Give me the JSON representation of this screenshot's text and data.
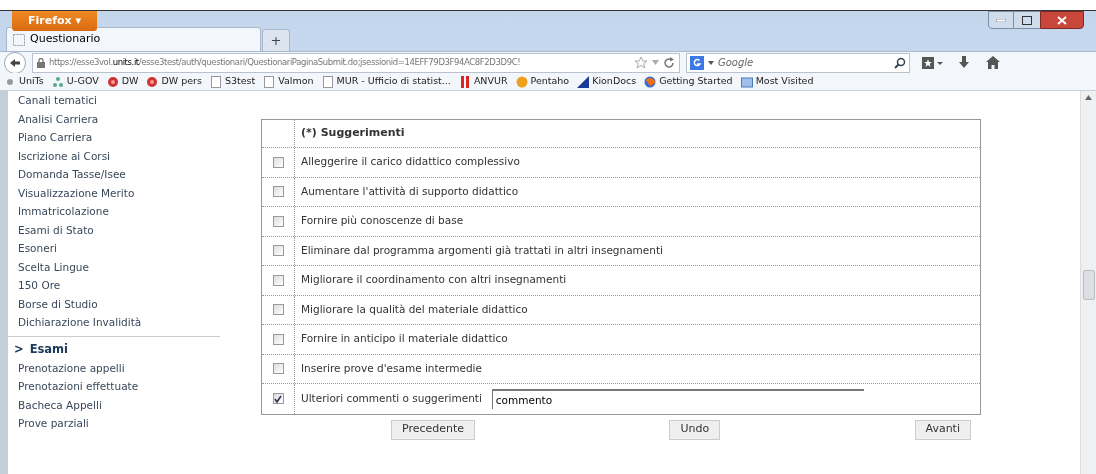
{
  "window": {
    "app_button": "Firefox ▾"
  },
  "tabs": [
    {
      "label": "Questionario",
      "selected": true
    },
    {
      "label": "+",
      "selected": false
    }
  ],
  "address_bar": {
    "prefix": "https://esse3vol.",
    "domain": "units.it",
    "path": "/esse3test/auth/questionari/QuestionariPaginaSubmit.do;jsessionid=14EFF79D3F94AC8F2D3D9C!"
  },
  "search_field": {
    "placeholder": "Google"
  },
  "bookmarks": [
    {
      "label": "UniTs",
      "kind": "dot"
    },
    {
      "label": "U-GOV",
      "kind": "nodes"
    },
    {
      "label": "DW",
      "kind": "flower"
    },
    {
      "label": "DW pers",
      "kind": "flower"
    },
    {
      "label": "S3test",
      "kind": "page"
    },
    {
      "label": "Valmon",
      "kind": "page"
    },
    {
      "label": "MUR - Ufficio di statist...",
      "kind": "page"
    },
    {
      "label": "ANVUR",
      "kind": "bars"
    },
    {
      "label": "Pentaho",
      "kind": "circle"
    },
    {
      "label": "KionDocs",
      "kind": "flag"
    },
    {
      "label": "Getting Started",
      "kind": "globe"
    },
    {
      "label": "Most Visited",
      "kind": "folder"
    }
  ],
  "sidebar": {
    "items": [
      {
        "label": "Canali tematici",
        "kind": "link"
      },
      {
        "label": "Analisi Carriera",
        "kind": "link"
      },
      {
        "label": "Piano Carriera",
        "kind": "link"
      },
      {
        "label": "Iscrizione ai Corsi",
        "kind": "link"
      },
      {
        "label": "Domanda Tasse/Isee",
        "kind": "link"
      },
      {
        "label": "Visualizzazione Merito",
        "kind": "link"
      },
      {
        "label": "Immatricolazione",
        "kind": "link"
      },
      {
        "label": "Esami di Stato",
        "kind": "link"
      },
      {
        "label": "Esoneri",
        "kind": "link"
      },
      {
        "label": "Scelta Lingue",
        "kind": "link"
      },
      {
        "label": "150 Ore",
        "kind": "link"
      },
      {
        "label": "Borse di Studio",
        "kind": "link"
      },
      {
        "label": "Dichiarazione Invalidità",
        "kind": "link"
      },
      {
        "label": "Esami",
        "kind": "section",
        "marker": ">"
      },
      {
        "label": "Prenotazione appelli",
        "kind": "link"
      },
      {
        "label": "Prenotazioni effettuate",
        "kind": "link"
      },
      {
        "label": "Bacheca Appelli",
        "kind": "link"
      },
      {
        "label": "Prove parziali",
        "kind": "link"
      }
    ]
  },
  "table": {
    "header": "(*) Suggerimenti",
    "rows": [
      {
        "label": "Alleggerire il carico didattico complessivo",
        "checked": false
      },
      {
        "label": "Aumentare l'attività di supporto didattico",
        "checked": false
      },
      {
        "label": "Fornire più conoscenze di base",
        "checked": false
      },
      {
        "label": "Eliminare dal programma argomenti già trattati in altri insegnamenti",
        "checked": false
      },
      {
        "label": "Migliorare il coordinamento con altri insegnamenti",
        "checked": false
      },
      {
        "label": "Migliorare la qualità del materiale didattico",
        "checked": false
      },
      {
        "label": "Fornire in anticipo il materiale didattico",
        "checked": false
      },
      {
        "label": "Inserire prove d'esame intermedie",
        "checked": false
      },
      {
        "label": "Ulteriori commenti o suggerimenti",
        "checked": true,
        "value": "commento"
      }
    ]
  },
  "buttons": [
    "Precedente",
    "Undo",
    "Avanti"
  ]
}
